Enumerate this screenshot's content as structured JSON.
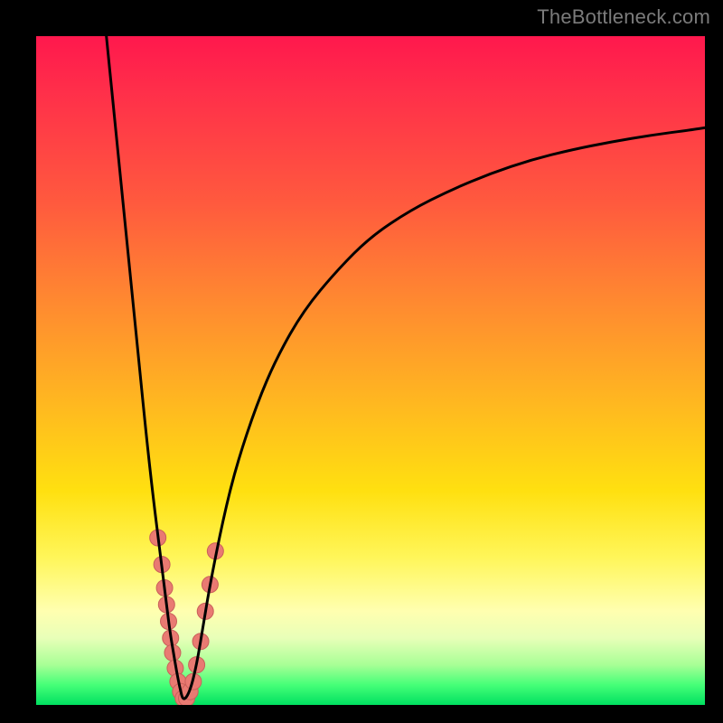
{
  "watermark": "TheBottleneck.com",
  "colors": {
    "frame": "#000000",
    "curve": "#000000",
    "marker_fill": "#e97a72",
    "marker_stroke": "#c9605a"
  },
  "chart_data": {
    "type": "line",
    "title": "",
    "xlabel": "",
    "ylabel": "",
    "xlim": [
      0,
      100
    ],
    "ylim": [
      0,
      100
    ],
    "grid": false,
    "legend": false,
    "series": [
      {
        "name": "left-branch",
        "x": [
          10.5,
          11.5,
          12.5,
          13.5,
          14.5,
          15.5,
          16.5,
          17.5,
          18.5,
          19.5,
          20,
          20.5,
          21,
          21.5,
          22
        ],
        "y": [
          100,
          90,
          80,
          70,
          60,
          50,
          40,
          31,
          23,
          15,
          11,
          8,
          5,
          2.5,
          0.5
        ]
      },
      {
        "name": "right-branch",
        "x": [
          22,
          23,
          24,
          25,
          26,
          28,
          30,
          33,
          36,
          40,
          45,
          50,
          56,
          62,
          68,
          74,
          80,
          86,
          92,
          98,
          100
        ],
        "y": [
          0.5,
          2,
          6,
          12,
          18,
          28,
          36,
          45,
          52,
          59,
          65,
          70,
          74,
          77,
          79.5,
          81.5,
          83,
          84.2,
          85.2,
          86,
          86.3
        ]
      }
    ],
    "markers": {
      "name": "highlight-points",
      "points": [
        {
          "x": 18.2,
          "y": 25
        },
        {
          "x": 18.8,
          "y": 21
        },
        {
          "x": 19.2,
          "y": 17.5
        },
        {
          "x": 19.5,
          "y": 15
        },
        {
          "x": 19.8,
          "y": 12.5
        },
        {
          "x": 20.1,
          "y": 10
        },
        {
          "x": 20.4,
          "y": 7.8
        },
        {
          "x": 20.8,
          "y": 5.5
        },
        {
          "x": 21.2,
          "y": 3.5
        },
        {
          "x": 21.6,
          "y": 2
        },
        {
          "x": 22.0,
          "y": 1
        },
        {
          "x": 22.5,
          "y": 1
        },
        {
          "x": 23.0,
          "y": 2
        },
        {
          "x": 23.5,
          "y": 3.5
        },
        {
          "x": 24.0,
          "y": 6
        },
        {
          "x": 24.6,
          "y": 9.5
        },
        {
          "x": 25.3,
          "y": 14
        },
        {
          "x": 26.0,
          "y": 18
        },
        {
          "x": 26.8,
          "y": 23
        }
      ],
      "radius": 9
    }
  }
}
